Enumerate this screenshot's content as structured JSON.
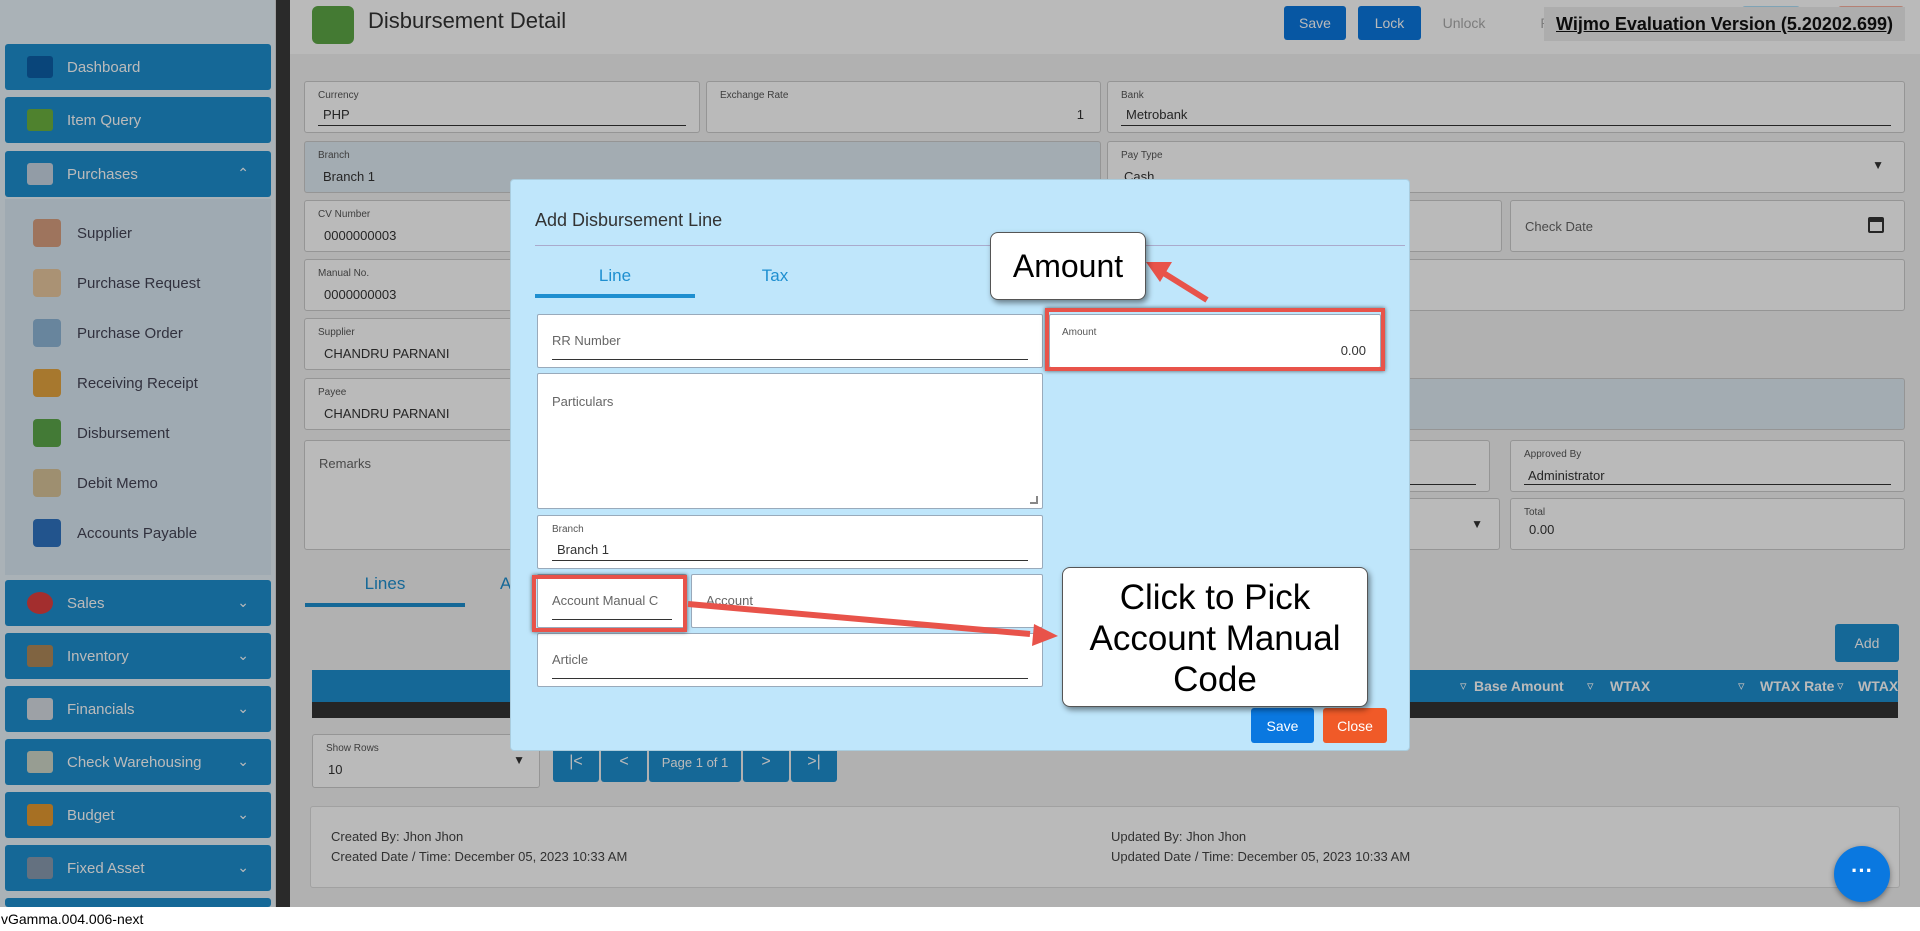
{
  "app": {
    "page_title": "Disbursement Detail",
    "version": "vGamma.004.006-next"
  },
  "toolbar": {
    "save": "Save",
    "lock": "Lock",
    "unlock": "Unlock",
    "partial": "P"
  },
  "watermark": "Wijmo Evaluation Version (5.20202.699)",
  "sidebar": {
    "dashboard": "Dashboard",
    "item_query": "Item Query",
    "purchases": "Purchases",
    "sub": [
      "Supplier",
      "Purchase Request",
      "Purchase Order",
      "Receiving Receipt",
      "Disbursement",
      "Debit Memo",
      "Accounts Payable"
    ],
    "sections": [
      "Sales",
      "Inventory",
      "Financials",
      "Check Warehousing",
      "Budget",
      "Fixed Asset"
    ]
  },
  "form": {
    "currency_label": "Currency",
    "currency": "PHP",
    "rate_label": "Exchange Rate",
    "rate": "1",
    "bank_label": "Bank",
    "bank": "Metrobank",
    "branch_label": "Branch",
    "branch": "Branch 1",
    "paytype_label": "Pay Type",
    "paytype": "Cash",
    "cv_label": "CV Number",
    "cv": "0000000003",
    "check_date_ph": "Check Date",
    "manual_label": "Manual No.",
    "manual": "0000000003",
    "supplier_label": "Supplier",
    "supplier": "CHANDRU PARNANI",
    "payee_label": "Payee",
    "payee": "CHANDRU PARNANI",
    "remarks_ph": "Remarks",
    "approved_label": "Approved By",
    "approved": "Administrator",
    "total_label": "Total",
    "total": "0.00"
  },
  "tabs": {
    "lines": "Lines",
    "partial": "A"
  },
  "grid": {
    "add": "Add",
    "columns": [
      "Base Amount",
      "WTAX",
      "WTAX Rate",
      "WTAX"
    ]
  },
  "pager": {
    "rows_label": "Show Rows",
    "rows": "10",
    "page": "Page 1 of 1"
  },
  "footer": {
    "created_by": "Created By: Jhon Jhon",
    "created_at": "Created Date / Time: December 05, 2023 10:33 AM",
    "updated_by": "Updated By: Jhon Jhon",
    "updated_at": "Updated Date / Time: December 05, 2023 10:33 AM"
  },
  "modal": {
    "title": "Add Disbursement Line",
    "tab_line": "Line",
    "tab_tax": "Tax",
    "rr_ph": "RR Number",
    "amount_label": "Amount",
    "amount": "0.00",
    "particulars_ph": "Particulars",
    "branch_label": "Branch",
    "branch": "Branch 1",
    "account_manual_ph": "Account Manual C",
    "account_ph": "Account",
    "article_ph": "Article",
    "save": "Save",
    "close": "Close"
  },
  "callouts": {
    "amount": "Amount",
    "account": "Click to Pick Account Manual Code"
  },
  "colors": {
    "primary": "#1e8fd0",
    "save": "#0a78e0",
    "close": "#f05a28",
    "highlight": "#e8534a",
    "modal_bg": "#bfe6fb"
  }
}
